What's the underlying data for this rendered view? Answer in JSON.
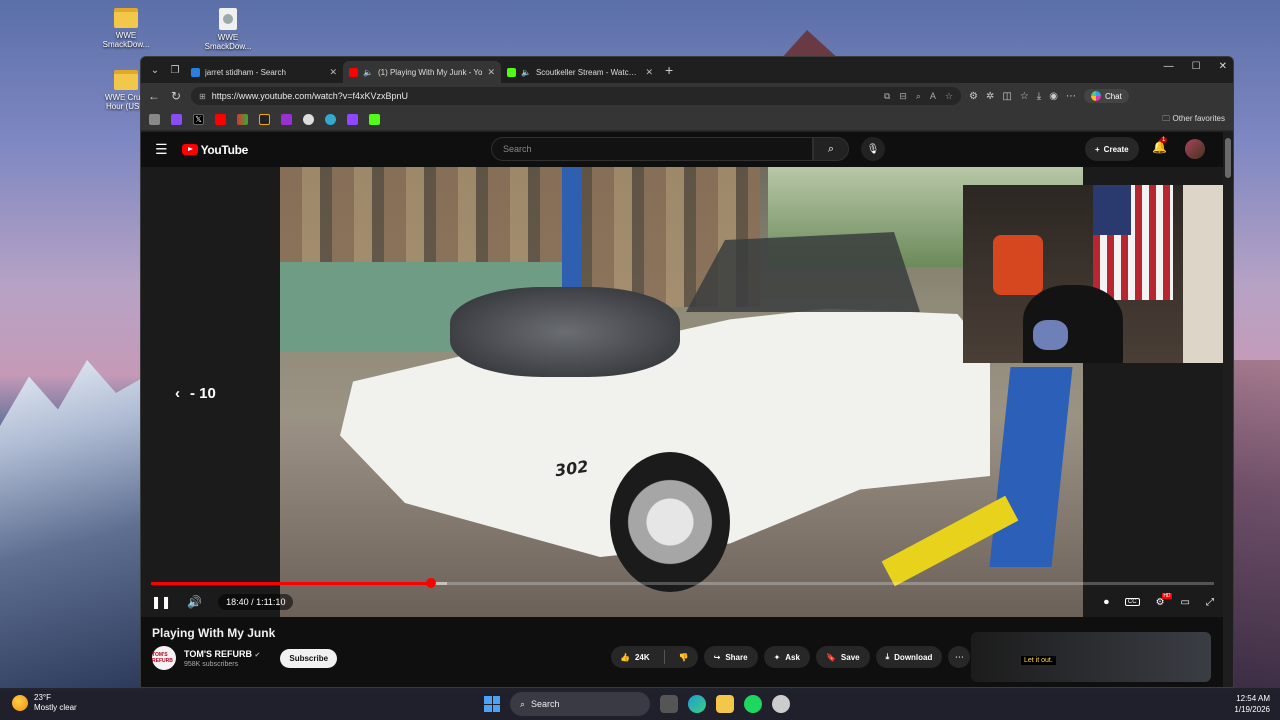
{
  "desktop": {
    "icons": [
      {
        "label": "WWE SmackDow...",
        "kind": "folder"
      },
      {
        "label": "WWE SmackDow...",
        "kind": "file"
      },
      {
        "label": "WWE Cru... Hour (US...",
        "kind": "folder"
      }
    ]
  },
  "browser": {
    "tabs": [
      {
        "title": "jarret stidham - Search",
        "favicon": "bing-search-icon",
        "active": false
      },
      {
        "title": "(1) Playing With My Junk - Yo",
        "favicon": "youtube-icon",
        "active": true,
        "audio": true
      },
      {
        "title": "Scoutkeller Stream - Watch Li",
        "favicon": "kick-icon",
        "active": false,
        "audio": true
      }
    ],
    "url": "https://www.youtube.com/watch?v=f4xKVzxBpnU",
    "chat_label": "Chat",
    "other_favorites": "Other favorites",
    "bookmark_icons": [
      "favorites-icon",
      "purple-app-icon",
      "x-icon",
      "youtube-icon",
      "flag-icon",
      "black-square-icon",
      "purple-p-icon",
      "github-icon",
      "blue-arc-icon",
      "twitch-icon",
      "kick-icon"
    ]
  },
  "youtube": {
    "logo_text": "YouTube",
    "search_placeholder": "Search",
    "create_label": "Create",
    "notification_count": "1",
    "player": {
      "rewind_label": "- 10",
      "time_display": "18:40 / 1:11:10",
      "progress_fraction": 0.263,
      "buffer_fraction": 0.278,
      "car_badge": "302"
    },
    "video": {
      "title": "Playing With My Junk",
      "channel": "TOM'S REFURB",
      "channel_avatar_text": "TOM'S REFURB",
      "subscribers": "958K subscribers",
      "subscribe_label": "Subscribe",
      "likes": "24K",
      "share_label": "Share",
      "ask_label": "Ask",
      "save_label": "Save",
      "download_label": "Download"
    },
    "sidebar_thumb_caption": "Let it out."
  },
  "taskbar": {
    "temperature": "23°F",
    "weather": "Mostly clear",
    "search_label": "Search",
    "time": "12:54 AM",
    "date": "1/19/2026"
  },
  "colors": {
    "youtube_red": "#ff0000",
    "browser_bg": "#202124",
    "page_bg": "#0f0f0f"
  }
}
